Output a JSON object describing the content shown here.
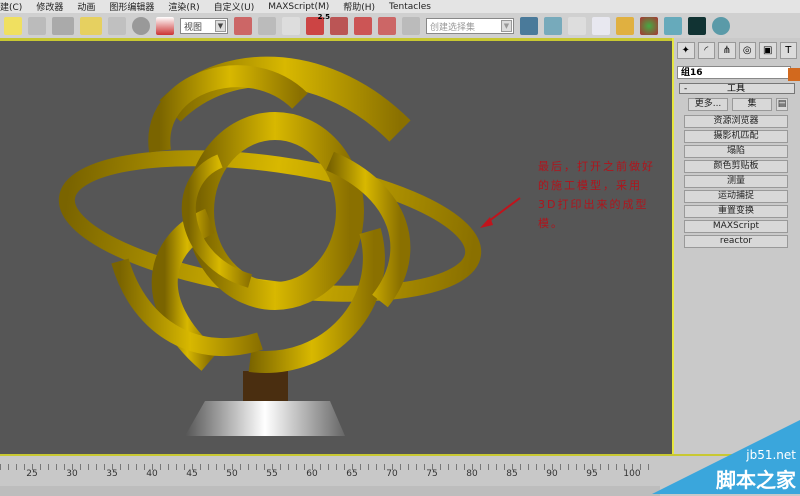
{
  "menu": [
    "建(C)",
    "修改器",
    "动画",
    "图形编辑器",
    "渲染(R)",
    "自定义(U)",
    "MAXScript(M)",
    "帮助(H)",
    "Tentacles"
  ],
  "toolbar": {
    "view_select": "视图",
    "selection_set_placeholder": "创建选择集",
    "snap_value": "2.5"
  },
  "annotation": "最后，打开之前做好的施工模型，采用3D打印出来的成型模。",
  "panel": {
    "object_name": "组16",
    "rollout_minus": "-",
    "rollout_title": "工具",
    "more_button": "更多...",
    "sets_button": "集",
    "tools": [
      "资源浏览器",
      "摄影机匹配",
      "塌陷",
      "颜色剪贴板",
      "测量",
      "运动捕捉",
      "重置变换",
      "MAXScript",
      "reactor"
    ]
  },
  "colors": {
    "sculpture": "#c8a800",
    "object_color": "#d2691e",
    "annotation": "#b0141c"
  },
  "timeline": {
    "labels": [
      "25",
      "30",
      "35",
      "40",
      "45",
      "50",
      "55",
      "60",
      "65",
      "70",
      "75",
      "80",
      "85",
      "90",
      "95",
      "100"
    ]
  },
  "watermark": {
    "site": "jb51.net",
    "name": "脚本之家"
  }
}
